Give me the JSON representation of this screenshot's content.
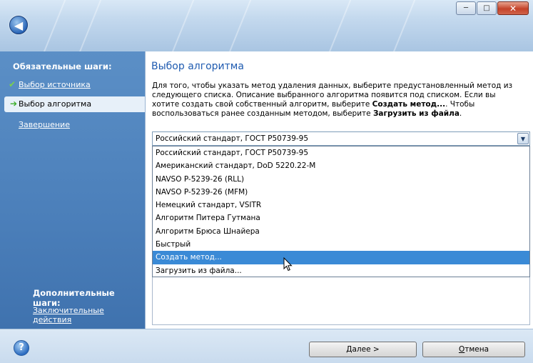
{
  "window": {
    "minimize_glyph": "─",
    "maximize_glyph": "□",
    "close_glyph": "✕",
    "back_glyph": "◀"
  },
  "sidebar": {
    "required_heading": "Обязательные шаги:",
    "items": [
      {
        "label": "Выбор источника",
        "status": "done"
      },
      {
        "label": "Выбор алгоритма",
        "status": "current"
      },
      {
        "label": "Завершение",
        "status": "pending"
      }
    ],
    "optional_heading": "Дополнительные шаги:",
    "optional_item": "Заключительные действия",
    "check_glyph": "✔",
    "current_glyph": "➔"
  },
  "main": {
    "title": "Выбор алгоритма",
    "desc_part1": "Для того, чтобы указать метод удаления данных, выберите предустановленный метод из следующего списка. Описание выбранного алгоритма появится под списком. Если вы хотите создать свой собственный алгоритм, выберите ",
    "desc_bold1": "Создать метод...",
    "desc_part2": ". Чтобы воспользоваться ранее созданным методом, выберите ",
    "desc_bold2": "Загрузить из файла",
    "desc_part3": ".",
    "combo_value": "Российский стандарт, ГОСТ Р50739-95",
    "options": [
      "Российский стандарт, ГОСТ Р50739-95",
      "Американский стандарт, DoD 5220.22-M",
      "NAVSO P-5239-26 (RLL)",
      "NAVSO P-5239-26 (MFM)",
      "Немецкий стандарт, VSITR",
      "Алгоритм Питера Гутмана",
      "Алгоритм Брюса Шнайера",
      "Быстрый",
      "Создать метод...",
      "Загрузить из файла..."
    ],
    "selected_option": "Создать метод..."
  },
  "footer": {
    "help_glyph": "?",
    "next_underlined": "Д",
    "next_rest": "алее >",
    "cancel_underlined": "О",
    "cancel_rest": "тмена"
  }
}
